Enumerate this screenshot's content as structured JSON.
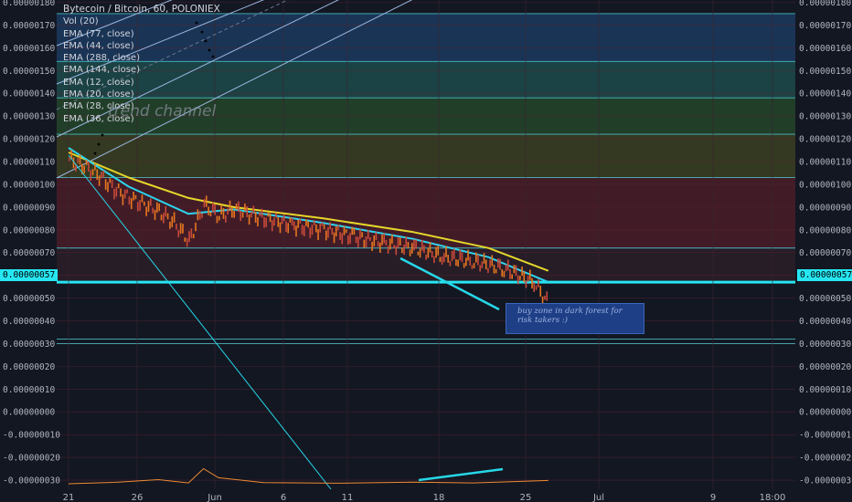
{
  "chart_data": {
    "type": "line",
    "title": "Bytecoin / Bitcoin, 60, POLONIEX",
    "indicators": [
      "Vol (20)",
      "EMA (77, close)",
      "EMA (44, close)",
      "EMA (288, close)",
      "EMA (144, close)",
      "EMA (12, close)",
      "EMA (20, close)",
      "EMA (28, close)",
      "EMA (36, close)"
    ],
    "y_ticks": [
      "0.00000180",
      "0.00000170",
      "0.00000160",
      "0.00000150",
      "0.00000140",
      "0.00000130",
      "0.00000120",
      "0.00000110",
      "0.00000100",
      "0.00000090",
      "0.00000080",
      "0.00000070",
      "0.00000060",
      "0.00000050",
      "0.00000040",
      "0.00000030",
      "0.00000020",
      "0.00000010",
      "0.00000000",
      "-0.00000010",
      "-0.00000020",
      "-0.00000030"
    ],
    "x_ticks": [
      "21",
      "26",
      "Jun",
      "6",
      "11",
      "18",
      "25",
      "Jul",
      "9",
      "18:00"
    ],
    "ylim": [
      -3.4e-07,
      1.81e-06
    ],
    "current_price": "0.00000057",
    "price_series": {
      "x": [
        "May 21",
        "May 22",
        "May 23",
        "May 24",
        "May 25",
        "May 26",
        "May 27",
        "May 28",
        "May 29",
        "May 30",
        "May 31",
        "Jun 1",
        "Jun 2",
        "Jun 3",
        "Jun 5",
        "Jun 7",
        "Jun 9",
        "Jun 11",
        "Jun 13",
        "Jun 15",
        "Jun 17",
        "Jun 19",
        "Jun 21",
        "Jun 22"
      ],
      "close": [
        1.11e-06,
        1.08e-06,
        1.04e-06,
        9.8e-07,
        9.4e-07,
        9.1e-07,
        8.8e-07,
        8.3e-07,
        7.5e-07,
        9.1e-07,
        8.6e-07,
        8.9e-07,
        8.7e-07,
        8.5e-07,
        8.2e-07,
        8e-07,
        7.7e-07,
        7.4e-07,
        7.2e-07,
        6.8e-07,
        6.6e-07,
        6.3e-07,
        5.7e-07,
        4.7e-07
      ]
    },
    "ema_slow": {
      "name": "EMA (288, close)",
      "x": [
        "May 21",
        "May 25",
        "May 29",
        "Jun 1",
        "Jun 7",
        "Jun 13",
        "Jun 18",
        "Jun 22"
      ],
      "values": [
        1.14e-06,
        1.03e-06,
        9.4e-07,
        9e-07,
        8.5e-07,
        7.9e-07,
        7.2e-07,
        6.2e-07
      ]
    },
    "ema_mid": {
      "name": "EMA (144, close)",
      "x": [
        "May 21",
        "May 25",
        "May 29",
        "Jun 1",
        "Jun 7",
        "Jun 13",
        "Jun 18",
        "Jun 22"
      ],
      "values": [
        1.16e-06,
        9.9e-07,
        8.7e-07,
        8.9e-07,
        8.3e-07,
        7.6e-07,
        6.8e-07,
        5.7e-07
      ]
    },
    "horizontal_levels": [
      1.75e-06,
      1.54e-06,
      1.38e-06,
      1.22e-06,
      1.03e-06,
      7.2e-07,
      5.7e-07,
      3.2e-07,
      3e-07
    ],
    "zones": [
      {
        "from": 1.54e-06,
        "to": 1.75e-06,
        "color": "#1c3a5e"
      },
      {
        "from": 1.38e-06,
        "to": 1.54e-06,
        "color": "#1d4a4a"
      },
      {
        "from": 1.22e-06,
        "to": 1.38e-06,
        "color": "#25452a"
      },
      {
        "from": 1.03e-06,
        "to": 1.22e-06,
        "color": "#3b3f22"
      },
      {
        "from": 7.2e-07,
        "to": 1.03e-06,
        "color": "#4a1d28"
      },
      {
        "from": 5.7e-07,
        "to": 7.2e-07,
        "color": "#2c1e28"
      }
    ],
    "drawings": {
      "channel_label": "trend channel",
      "note": "buy zone in dark forest for risk takers :)"
    },
    "colors": {
      "background": "#131722",
      "ema_slow": "#e5d62a",
      "ema_mid": "#2dd3ec",
      "price": "#e8761f",
      "current_price": "#26e6f2",
      "volume": "#ef8a33",
      "trendline": "#26d7e8"
    },
    "volume": {
      "x": [
        "May 21",
        "May 24",
        "May 27",
        "May 29",
        "May 30",
        "May 31",
        "Jun 3",
        "Jun 8",
        "Jun 13",
        "Jun 17",
        "Jun 22"
      ],
      "values": [
        0.0,
        5e-07,
        1.5e-06,
        3e-07,
        5.5e-06,
        2.2e-06,
        4e-07,
        2e-07,
        6e-07,
        3e-07,
        1.2e-06
      ]
    }
  }
}
